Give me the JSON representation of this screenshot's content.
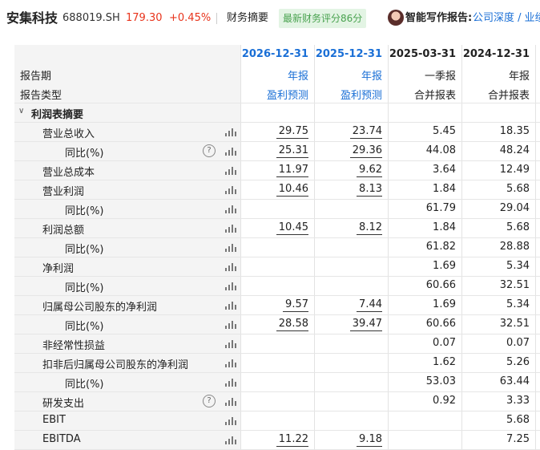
{
  "header": {
    "stock_name": "安集科技",
    "stock_code": "688019.SH",
    "price": "179.30",
    "change": "+0.45%",
    "summary_tab": "财务摘要",
    "score_badge": "最新财务评分86分",
    "ai_report_label": "智能写作报告:",
    "ai_report_links": "公司深度 / 业绩"
  },
  "table": {
    "header_rows": {
      "period_label": "报告期",
      "type_label": "报告类型"
    },
    "columns": [
      {
        "date": "2026-12-31",
        "type": "年报",
        "subtype": "盈利预测",
        "forecast": true
      },
      {
        "date": "2025-12-31",
        "type": "年报",
        "subtype": "盈利预测",
        "forecast": true
      },
      {
        "date": "2025-03-31",
        "type": "一季报",
        "subtype": "合并报表",
        "forecast": false
      },
      {
        "date": "2024-12-31",
        "type": "年报",
        "subtype": "合并报表",
        "forecast": false
      }
    ],
    "section_title": "利润表摘要",
    "rows": [
      {
        "label": "营业总收入",
        "indent": 1,
        "help": false,
        "values": [
          "29.75",
          "23.74",
          "5.45",
          "18.35"
        ]
      },
      {
        "label": "同比(%)",
        "indent": 2,
        "help": true,
        "values": [
          "25.31",
          "29.36",
          "44.08",
          "48.24"
        ]
      },
      {
        "label": "营业总成本",
        "indent": 1,
        "help": false,
        "values": [
          "11.97",
          "9.62",
          "3.64",
          "12.49"
        ]
      },
      {
        "label": "营业利润",
        "indent": 1,
        "help": false,
        "values": [
          "10.46",
          "8.13",
          "1.84",
          "5.68"
        ]
      },
      {
        "label": "同比(%)",
        "indent": 2,
        "help": false,
        "values": [
          "",
          "",
          "61.79",
          "29.04"
        ]
      },
      {
        "label": "利润总额",
        "indent": 1,
        "help": false,
        "values": [
          "10.45",
          "8.12",
          "1.84",
          "5.68"
        ]
      },
      {
        "label": "同比(%)",
        "indent": 2,
        "help": false,
        "values": [
          "",
          "",
          "61.82",
          "28.88"
        ]
      },
      {
        "label": "净利润",
        "indent": 1,
        "help": false,
        "values": [
          "",
          "",
          "1.69",
          "5.34"
        ]
      },
      {
        "label": "同比(%)",
        "indent": 2,
        "help": false,
        "values": [
          "",
          "",
          "60.66",
          "32.51"
        ]
      },
      {
        "label": "归属母公司股东的净利润",
        "indent": 1,
        "help": false,
        "values": [
          "9.57",
          "7.44",
          "1.69",
          "5.34"
        ]
      },
      {
        "label": "同比(%)",
        "indent": 2,
        "help": false,
        "values": [
          "28.58",
          "39.47",
          "60.66",
          "32.51"
        ]
      },
      {
        "label": "非经常性损益",
        "indent": 1,
        "help": false,
        "values": [
          "",
          "",
          "0.07",
          "0.07"
        ]
      },
      {
        "label": "扣非后归属母公司股东的净利润",
        "indent": 1,
        "help": false,
        "values": [
          "",
          "",
          "1.62",
          "5.26"
        ]
      },
      {
        "label": "同比(%)",
        "indent": 2,
        "help": false,
        "values": [
          "",
          "",
          "53.03",
          "63.44"
        ]
      },
      {
        "label": "研发支出",
        "indent": 1,
        "help": true,
        "values": [
          "",
          "",
          "0.92",
          "3.33"
        ]
      },
      {
        "label": "EBIT",
        "indent": 1,
        "help": false,
        "values": [
          "",
          "",
          "",
          "5.68"
        ]
      },
      {
        "label": "EBITDA",
        "indent": 1,
        "help": false,
        "values": [
          "11.22",
          "9.18",
          "",
          "7.25"
        ]
      }
    ]
  },
  "icons": {
    "chart": "bar-chart-icon",
    "help": "question-circle-icon",
    "collapse": "chevron-down-icon"
  },
  "colors": {
    "up": "#e8341c",
    "link": "#1a6fd6",
    "badge_bg": "#e3f4e4",
    "badge_text": "#49a24f"
  }
}
